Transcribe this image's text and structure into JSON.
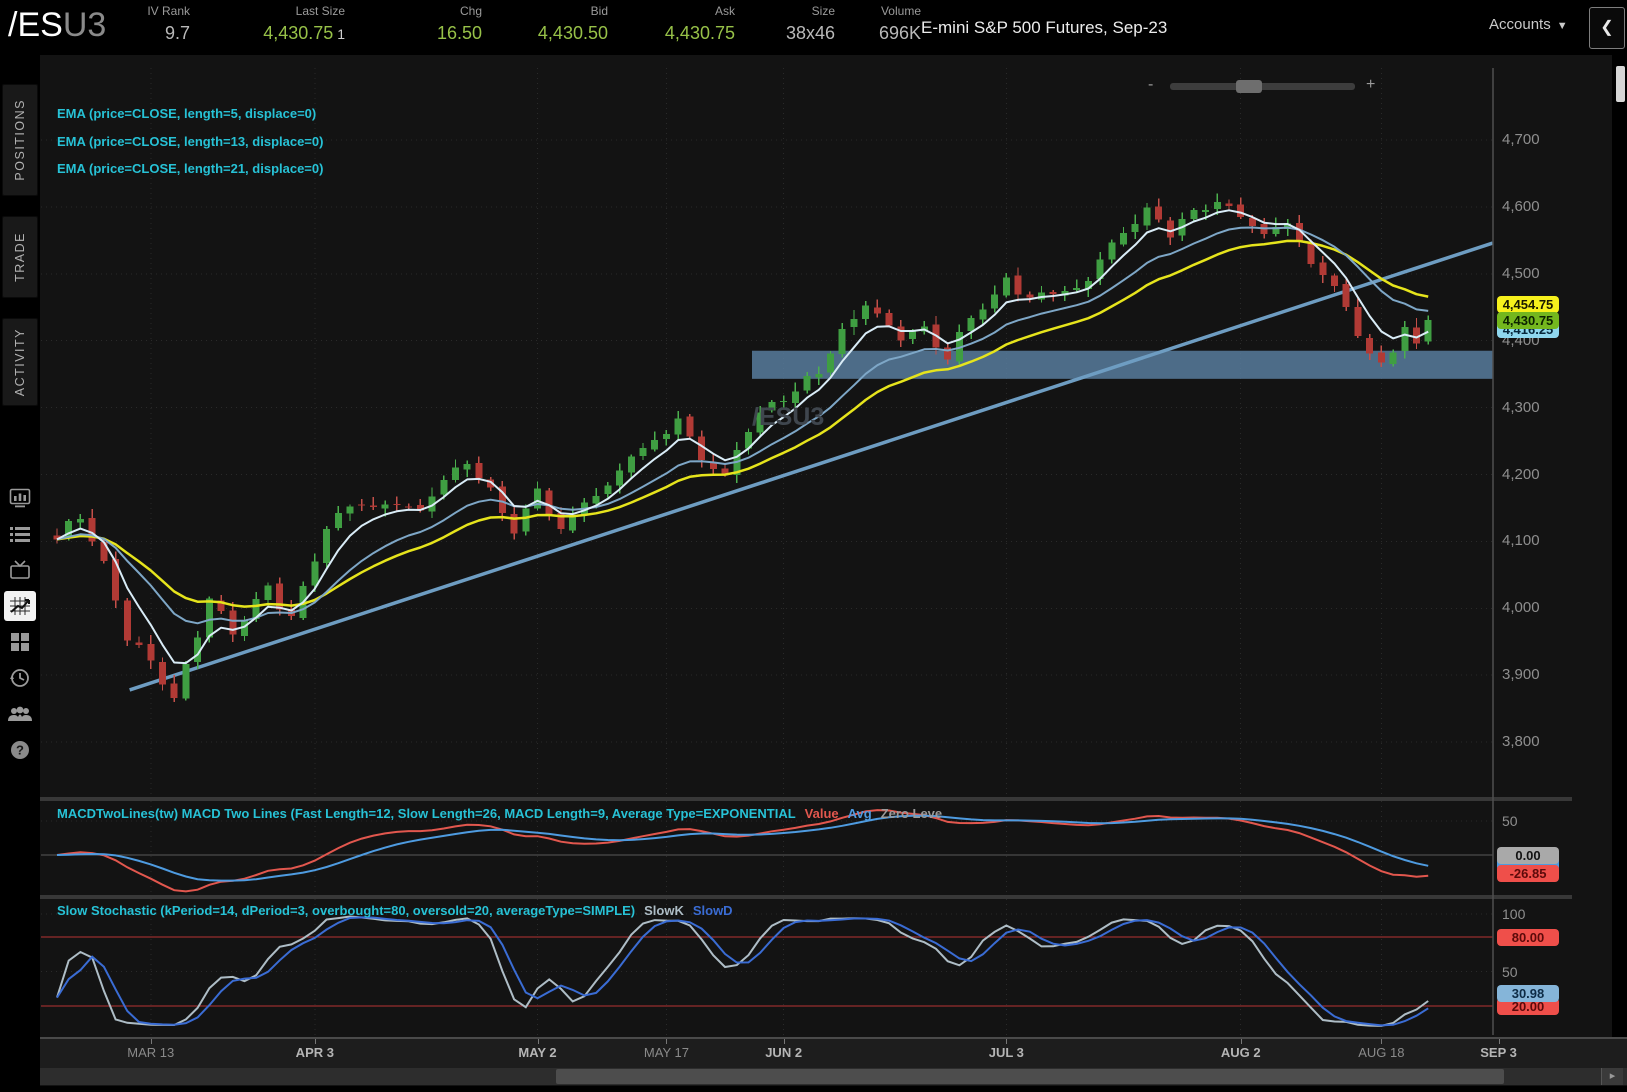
{
  "header": {
    "symbol": "/ES",
    "symbol_suffix": "U3",
    "stats": [
      {
        "label": "IV Rank",
        "value": "9.7",
        "color": "gray"
      },
      {
        "label": "Last Size",
        "value": "4,430.75",
        "extra": "1",
        "color": "green"
      },
      {
        "label": "Chg",
        "value": "16.50",
        "color": "green"
      },
      {
        "label": "Bid",
        "value": "4,430.50",
        "color": "green"
      },
      {
        "label": "Ask",
        "value": "4,430.75",
        "color": "green"
      },
      {
        "label": "Size",
        "value": "38x46",
        "color": "gray"
      },
      {
        "label": "Volume",
        "value": "696K",
        "color": "gray"
      }
    ],
    "description": "E-mini S&P 500 Futures, Sep-23",
    "accounts_label": "Accounts",
    "collapse_glyph": "❮"
  },
  "sidebar": {
    "tabs": [
      {
        "label": "POSITIONS"
      },
      {
        "label": "TRADE"
      },
      {
        "label": "ACTIVITY"
      }
    ],
    "icons": [
      "market-monitor",
      "watchlist",
      "tv",
      "charts",
      "grid",
      "history",
      "community",
      "help"
    ],
    "active_icon": "charts"
  },
  "zoom_control": {
    "minus": "-",
    "plus": "+"
  },
  "scrollbar": {
    "right_arrow": "▸"
  },
  "chart": {
    "ema_labels": [
      "EMA (price=CLOSE, length=5, displace=0)",
      "EMA (price=CLOSE, length=13, displace=0)",
      "EMA (price=CLOSE, length=21, displace=0)"
    ],
    "watermark": "/ESU3",
    "price_bubbles": [
      {
        "text": "4,416.25",
        "price": 4416.25,
        "bg": "#8fd7ee",
        "fg": "#06263a"
      },
      {
        "text": "4,454.75",
        "price": 4454.75,
        "bg": "#f7f11c",
        "fg": "#1a1a00"
      },
      {
        "text": "4,430.75",
        "price": 4430.75,
        "bg": "#74b71e",
        "fg": "#0c2200"
      }
    ]
  },
  "macd": {
    "title": "MACDTwoLines(tw) MACD Two Lines (Fast Length=12, Slow Length=26, MACD Length=9, Average Type=EXPONENTIAL",
    "plots": [
      {
        "label": "Value",
        "color": "#e2574e"
      },
      {
        "label": "Avg",
        "color": "#4e9be0"
      },
      {
        "label": "Zero Leve",
        "color": "#9a9a9a"
      }
    ],
    "axis_labels": [
      {
        "value": 50,
        "text": "50"
      }
    ],
    "bubbles": [
      {
        "text": "",
        "value": -11,
        "bg": "#4e9be0",
        "fg": "#0a2238"
      },
      {
        "text": "-26.85",
        "value": -26.85,
        "bg": "#ef4f4a",
        "fg": "#5c0a0a"
      },
      {
        "text": "0.00",
        "value": 0,
        "bg": "#a9a9a9",
        "fg": "#111111"
      }
    ]
  },
  "stoch": {
    "title": "Slow Stochastic (kPeriod=14, dPeriod=3, overbought=80, oversold=20, averageType=SIMPLE)",
    "plots": [
      {
        "label": "SlowK",
        "color": "#aebdc6"
      },
      {
        "label": "SlowD",
        "color": "#3a6cd4"
      }
    ],
    "axis_labels": [
      {
        "value": 100,
        "text": "100"
      },
      {
        "value": 50,
        "text": "50"
      }
    ],
    "bubbles": [
      {
        "text": "20.00",
        "value": 20,
        "bg": "#ef4f4a",
        "fg": "#5c0a0a"
      },
      {
        "text": "80.00",
        "value": 80,
        "bg": "#ef4f4a",
        "fg": "#5c0a0a"
      },
      {
        "text": "30.98",
        "value": 30.98,
        "bg": "#85b5d9",
        "fg": "#0d2b45"
      }
    ]
  },
  "chart_data": {
    "type": "candlestick",
    "symbol": "/ESU3",
    "description": "E-mini S&P 500 Futures, Sep-23",
    "bars": 118,
    "last_close": 4430.75,
    "x_map": {
      "x0": 57,
      "dx": 11.72
    },
    "y_map": {
      "p_ref": 4700,
      "y_ref": 140,
      "scale": 0.669
    },
    "y_ticks": [
      {
        "v": 4700,
        "label": "4,700"
      },
      {
        "v": 4600,
        "label": "4,600"
      },
      {
        "v": 4500,
        "label": "4,500"
      },
      {
        "v": 4400,
        "label": "4,400"
      },
      {
        "v": 4300,
        "label": "4,300"
      },
      {
        "v": 4200,
        "label": "4,200"
      },
      {
        "v": 4100,
        "label": "4,100"
      },
      {
        "v": 4000,
        "label": "4,000"
      },
      {
        "v": 3900,
        "label": "3,900"
      },
      {
        "v": 3800,
        "label": "3,800"
      }
    ],
    "x_ticks": [
      {
        "label": "MAR 13",
        "i": 8,
        "major": false
      },
      {
        "label": "APR 3",
        "i": 22,
        "major": true
      },
      {
        "label": "MAY 2",
        "i": 41,
        "major": true
      },
      {
        "label": "MAY 17",
        "i": 52,
        "major": false
      },
      {
        "label": "JUN 2",
        "i": 62,
        "major": true
      },
      {
        "label": "JUL 3",
        "i": 81,
        "major": true
      },
      {
        "label": "AUG 2",
        "i": 101,
        "major": true
      },
      {
        "label": "AUG 18",
        "i": 113,
        "major": false
      },
      {
        "label": "SEP 3",
        "i": 123,
        "major": true
      }
    ],
    "close_anchors": [
      [
        0,
        4108
      ],
      [
        2,
        4126
      ],
      [
        4,
        4060
      ],
      [
        6,
        3962
      ],
      [
        8,
        3925
      ],
      [
        10,
        3872
      ],
      [
        13,
        4005
      ],
      [
        15,
        3952
      ],
      [
        18,
        4040
      ],
      [
        20,
        3992
      ],
      [
        23,
        4120
      ],
      [
        25,
        4150
      ],
      [
        27,
        4138
      ],
      [
        29,
        4162
      ],
      [
        31,
        4155
      ],
      [
        33,
        4195
      ],
      [
        35,
        4215
      ],
      [
        37,
        4170
      ],
      [
        39,
        4108
      ],
      [
        41,
        4180
      ],
      [
        43,
        4130
      ],
      [
        45,
        4160
      ],
      [
        47,
        4172
      ],
      [
        49,
        4225
      ],
      [
        51,
        4242
      ],
      [
        53,
        4288
      ],
      [
        55,
        4235
      ],
      [
        57,
        4202
      ],
      [
        59,
        4258
      ],
      [
        61,
        4300
      ],
      [
        63,
        4328
      ],
      [
        65,
        4360
      ],
      [
        67,
        4420
      ],
      [
        69,
        4458
      ],
      [
        70,
        4425
      ],
      [
        72,
        4395
      ],
      [
        74,
        4418
      ],
      [
        76,
        4385
      ],
      [
        78,
        4442
      ],
      [
        80,
        4465
      ],
      [
        81,
        4492
      ],
      [
        83,
        4448
      ],
      [
        85,
        4470
      ],
      [
        87,
        4482
      ],
      [
        89,
        4528
      ],
      [
        91,
        4562
      ],
      [
        93,
        4590
      ],
      [
        95,
        4556
      ],
      [
        97,
        4588
      ],
      [
        99,
        4618
      ],
      [
        101,
        4598
      ],
      [
        103,
        4552
      ],
      [
        105,
        4572
      ],
      [
        107,
        4508
      ],
      [
        109,
        4482
      ],
      [
        111,
        4418
      ],
      [
        113,
        4372
      ],
      [
        114,
        4388
      ],
      [
        115,
        4418
      ],
      [
        116,
        4384
      ],
      [
        117,
        4431
      ]
    ],
    "noise": {
      "a1": 9,
      "f1": 0.55,
      "a2": 5,
      "f2": 1.9,
      "h": 0.55
    },
    "candle_width": 7,
    "colors": {
      "up_body": "#3f9e42",
      "up_wick": "#4bb04e",
      "down_body": "#b13a35",
      "down_wick": "#c4504a",
      "grid": "#2a2a2a",
      "axis_border": "#4f4f4f",
      "separator": "#383838",
      "zero_line": "#5a5a5a",
      "ob_os_line": "#b73333"
    },
    "emas": [
      {
        "len": 5,
        "color": "#d9ecf7",
        "w": 2
      },
      {
        "len": 13,
        "color": "#7ea7c7",
        "w": 2
      },
      {
        "len": 21,
        "color": "#e6e41c",
        "w": 2.5
      }
    ],
    "trendline": {
      "i1": 6.2,
      "p1": 3878,
      "i2": 122.5,
      "p2": 4546,
      "color": "#6e9dc2",
      "w": 3.5
    },
    "support_zone": {
      "i1": 59.3,
      "p_top": 4385,
      "p_bottom": 4343,
      "color": "#587d9e",
      "opacity": 0.85
    },
    "macd_cfg": {
      "fast": 12,
      "slow": 26,
      "signal": 9,
      "map": {
        "v_ref": 0,
        "y_ref": 855,
        "scale": 0.68
      },
      "value_color": "#e2574e",
      "avg_color": "#4e9be0",
      "grid_values": [
        50
      ]
    },
    "stoch_cfg": {
      "k": 14,
      "slow": 3,
      "d": 3,
      "overbought": 80,
      "oversold": 20,
      "map": {
        "v_ref": 0,
        "y_ref": 1029,
        "scale": 1.15
      },
      "k_color": "#aebdc6",
      "d_color": "#3a6cd4",
      "grid_values": [
        100,
        50
      ]
    }
  }
}
